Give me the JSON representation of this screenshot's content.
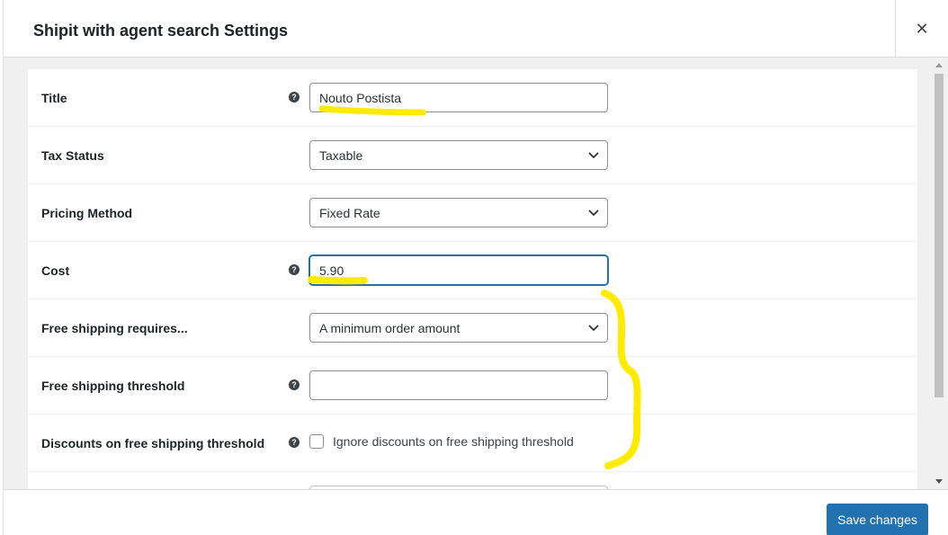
{
  "modal": {
    "title": "Shipit with agent search Settings",
    "close_glyph": "✕"
  },
  "form": {
    "title": {
      "label": "Title",
      "value": "Nouto Postista"
    },
    "tax_status": {
      "label": "Tax Status",
      "value": "Taxable"
    },
    "pricing_method": {
      "label": "Pricing Method",
      "value": "Fixed Rate"
    },
    "cost": {
      "label": "Cost",
      "value": "5.90"
    },
    "free_shipping_requires": {
      "label": "Free shipping requires...",
      "value": "A minimum order amount"
    },
    "free_shipping_threshold": {
      "label": "Free shipping threshold",
      "value": ""
    },
    "discounts": {
      "label": "Discounts on free shipping threshold",
      "checkbox_label": "Ignore discounts on free shipping threshold"
    }
  },
  "help_glyph": "?",
  "footer": {
    "save_label": "Save changes"
  },
  "colors": {
    "accent": "#2271b1",
    "highlight": "#ffeb00"
  }
}
